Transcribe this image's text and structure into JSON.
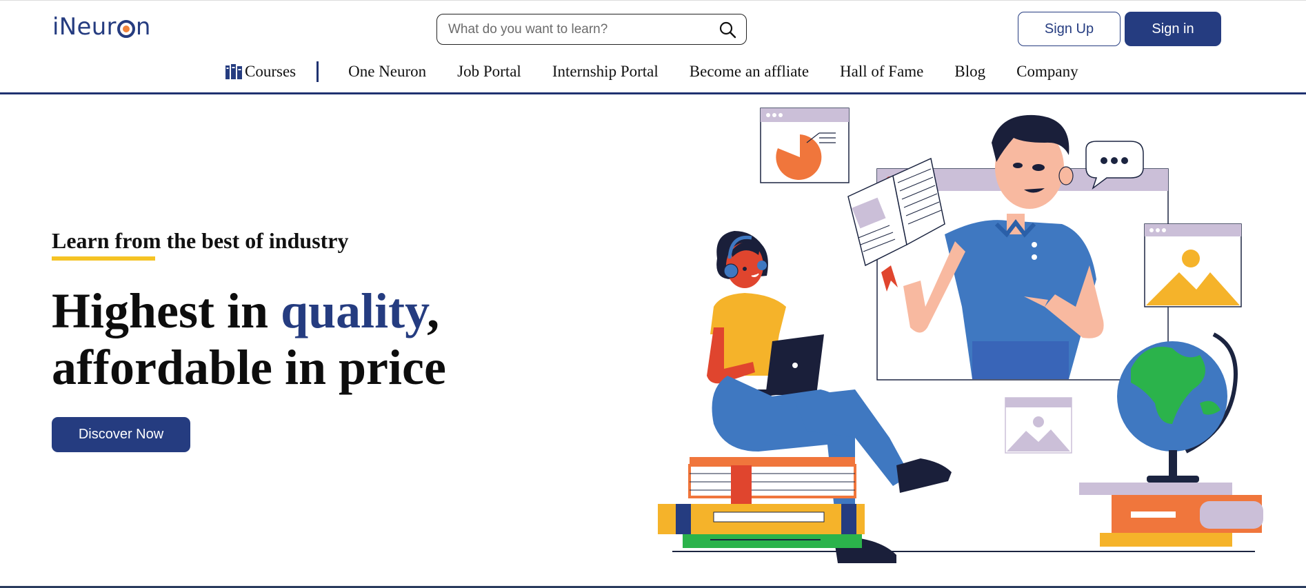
{
  "brand": {
    "logo_prefix": "iNeur",
    "logo_suffix": "n",
    "primary_color": "#253c80",
    "accent_color": "#f5c324"
  },
  "search": {
    "placeholder": "What do you want to learn?",
    "icon": "search-icon"
  },
  "auth": {
    "signup_label": "Sign Up",
    "signin_label": "Sign in"
  },
  "nav": {
    "courses_label": "Courses",
    "courses_icon": "books-icon",
    "items": [
      "One Neuron",
      "Job Portal",
      "Internship Portal",
      "Become an affliate",
      "Hall of Fame",
      "Blog",
      "Company"
    ]
  },
  "hero": {
    "tagline": "Learn from the best of industry",
    "headline_part1": "Highest in ",
    "headline_accent": "quality",
    "headline_part2": ",",
    "headline_line2": "affordable in price",
    "cta_label": "Discover Now",
    "illustration": "students-learning-illustration"
  }
}
